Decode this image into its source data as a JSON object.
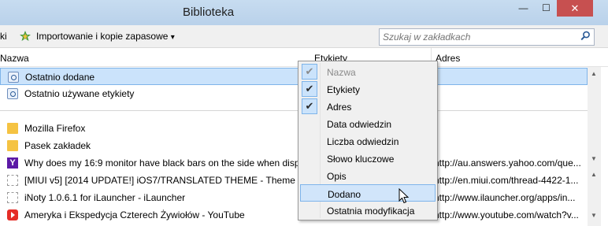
{
  "window": {
    "title": "Biblioteka",
    "min_glyph": "—",
    "max_glyph": "☐",
    "close_glyph": "✕"
  },
  "toolbar": {
    "left_fragment": "ki",
    "import_label": "Importowanie i kopie zapasowe",
    "import_arrow": "▾"
  },
  "search": {
    "placeholder": "Szukaj w zakładkach"
  },
  "columns": {
    "name": "Nazwa",
    "tags": "Etykiety",
    "address": "Adres"
  },
  "rows": [
    {
      "icon": "query-icon",
      "text": "Ostatnio dodane",
      "url": "",
      "selected": true
    },
    {
      "icon": "query-icon",
      "text": "Ostatnio używane etykiety",
      "url": ""
    },
    {
      "icon": "folder-icon",
      "text": "Mozilla Firefox",
      "url": ""
    },
    {
      "icon": "folder-icon",
      "text": "Pasek zakładek",
      "url": ""
    },
    {
      "icon": "yahoo-icon",
      "text": "Why does my 16:9 monitor have black bars on the side when displa",
      "url": "http://au.answers.yahoo.com/que..."
    },
    {
      "icon": "page-icon",
      "text": "[MIUI v5] [2014 UPDATE!] iOS7/TRANSLATED THEME - Theme - M",
      "url": "http://en.miui.com/thread-4422-1..."
    },
    {
      "icon": "page-icon",
      "text": "iNoty 1.0.6.1 for iLauncher - iLauncher",
      "url": "http://www.ilauncher.org/apps/in..."
    },
    {
      "icon": "youtube-icon",
      "text": "Ameryka i Ekspedycja Czterech Żywiołów - YouTube",
      "url": "http://www.youtube.com/watch?v..."
    }
  ],
  "column_menu": {
    "items": [
      {
        "label": "Nazwa",
        "checked": true,
        "disabled": true
      },
      {
        "label": "Etykiety",
        "checked": true
      },
      {
        "label": "Adres",
        "checked": true
      },
      {
        "label": "Data odwiedzin",
        "checked": false
      },
      {
        "label": "Liczba odwiedzin",
        "checked": false
      },
      {
        "label": "Słowo kluczowe",
        "checked": false
      },
      {
        "label": "Opis",
        "checked": false
      },
      {
        "label": "Dodano",
        "checked": false,
        "hover": true
      },
      {
        "label": "Ostatnia modyfikacja",
        "checked": false
      }
    ],
    "check_glyph": "✔"
  },
  "colors": {
    "selection": "#cbe3fb",
    "selection_border": "#7eb4ea",
    "close": "#c75050"
  }
}
